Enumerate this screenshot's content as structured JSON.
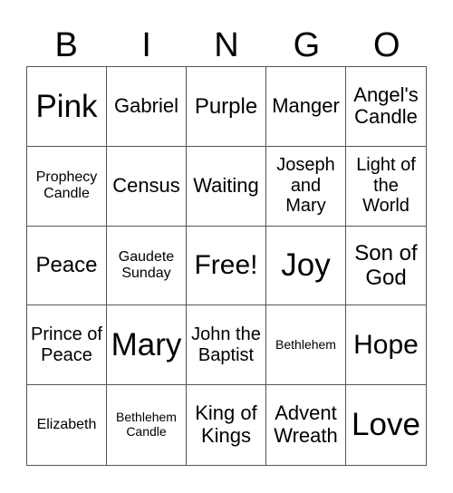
{
  "header": {
    "letters": [
      "B",
      "I",
      "N",
      "G",
      "O"
    ]
  },
  "cells": [
    {
      "text": "Pink",
      "size": "xl"
    },
    {
      "text": "Gabriel",
      "size": "m"
    },
    {
      "text": "Purple",
      "size": "ml"
    },
    {
      "text": "Manger",
      "size": "m"
    },
    {
      "text": "Angel's Candle",
      "size": "m"
    },
    {
      "text": "Prophecy Candle",
      "size": "xs"
    },
    {
      "text": "Census",
      "size": "m"
    },
    {
      "text": "Waiting",
      "size": "m"
    },
    {
      "text": "Joseph and Mary",
      "size": "s"
    },
    {
      "text": "Light of the World",
      "size": "s"
    },
    {
      "text": "Peace",
      "size": "ml"
    },
    {
      "text": "Gaudete Sunday",
      "size": "xs"
    },
    {
      "text": "Free!",
      "size": "l"
    },
    {
      "text": "Joy",
      "size": "xl"
    },
    {
      "text": "Son of God",
      "size": "ml"
    },
    {
      "text": "Prince of Peace",
      "size": "s"
    },
    {
      "text": "Mary",
      "size": "xl"
    },
    {
      "text": "John the Baptist",
      "size": "s"
    },
    {
      "text": "Bethlehem",
      "size": "xxs"
    },
    {
      "text": "Hope",
      "size": "l"
    },
    {
      "text": "Elizabeth",
      "size": "xs"
    },
    {
      "text": "Bethlehem Candle",
      "size": "xxs"
    },
    {
      "text": "King of Kings",
      "size": "m"
    },
    {
      "text": "Advent Wreath",
      "size": "m"
    },
    {
      "text": "Love",
      "size": "xl"
    }
  ]
}
